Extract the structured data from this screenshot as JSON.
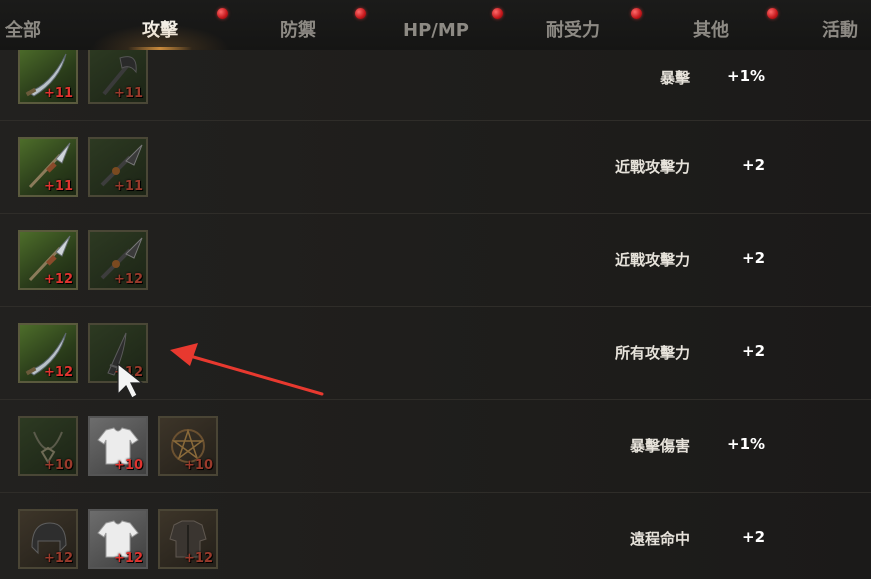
{
  "tabs": [
    {
      "label": "全部",
      "active": false,
      "dot": false
    },
    {
      "label": "攻擊",
      "active": true,
      "dot": true
    },
    {
      "label": "防禦",
      "active": false,
      "dot": true
    },
    {
      "label": "HP/MP",
      "active": false,
      "dot": true
    },
    {
      "label": "耐受力",
      "active": false,
      "dot": true
    },
    {
      "label": "其他",
      "active": false,
      "dot": false
    },
    {
      "label": "活動",
      "active": false,
      "dot": true
    }
  ],
  "rows": [
    {
      "stat": "暴擊",
      "value": "+1%",
      "items": [
        {
          "icon": "curved-sword-icon",
          "level": "+11",
          "style": "green"
        },
        {
          "icon": "dark-axe-icon",
          "level": "+11",
          "style": "dark"
        }
      ]
    },
    {
      "stat": "近戰攻擊力",
      "value": "+2",
      "items": [
        {
          "icon": "spear-icon",
          "level": "+11",
          "style": "green"
        },
        {
          "icon": "dark-spear-icon",
          "level": "+11",
          "style": "dark"
        }
      ]
    },
    {
      "stat": "近戰攻擊力",
      "value": "+2",
      "items": [
        {
          "icon": "spear-icon",
          "level": "+12",
          "style": "green"
        },
        {
          "icon": "dark-spear-icon",
          "level": "+12",
          "style": "dark"
        }
      ]
    },
    {
      "stat": "所有攻擊力",
      "value": "+2",
      "items": [
        {
          "icon": "curved-sword-icon",
          "level": "+12",
          "style": "green"
        },
        {
          "icon": "dark-blade-icon",
          "level": "+12",
          "style": "dark"
        }
      ]
    },
    {
      "stat": "暴擊傷害",
      "value": "+1%",
      "items": [
        {
          "icon": "necklace-icon",
          "level": "+10",
          "style": "green"
        },
        {
          "icon": "white-shirt-icon",
          "level": "+10",
          "style": "gray"
        },
        {
          "icon": "pentagram-amulet-icon",
          "level": "+10",
          "style": "brown"
        }
      ]
    },
    {
      "stat": "遠程命中",
      "value": "+2",
      "items": [
        {
          "icon": "helmet-icon",
          "level": "+12",
          "style": "dark"
        },
        {
          "icon": "white-shirt-icon",
          "level": "+12",
          "style": "gray"
        },
        {
          "icon": "leather-armor-icon",
          "level": "+12",
          "style": "brown"
        }
      ]
    }
  ],
  "colors": {
    "accent": "#c98a3c",
    "level_text": "#e0342f",
    "annotation_arrow": "#e8392f",
    "notification_dot": "#c4171b"
  },
  "annotation": {
    "type": "red-arrow",
    "target": "dark-blade-icon"
  }
}
